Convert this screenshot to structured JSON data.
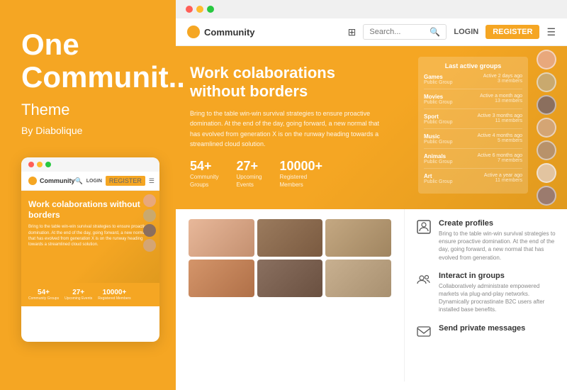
{
  "left_panel": {
    "title_line1": "One",
    "title_line2": "Communit..",
    "subtitle": "Theme",
    "author": "By Diabolique"
  },
  "mobile": {
    "logo": "Community",
    "hero_title": "Work colaborations without borders",
    "hero_body": "Bring to the table win-win survival strategies to ensure proactive domination. At the end of the day, going forward, a new normal that has evolved from generation X is on the runway heading towards a streamlined cloud solution.",
    "stats": [
      {
        "num": "54+",
        "label": "Community Groups"
      },
      {
        "num": "27+",
        "label": "Upcoming Events"
      },
      {
        "num": "10000+",
        "label": "Registered Members"
      }
    ],
    "nav_links": [
      "LOGIN",
      "REGISTER"
    ]
  },
  "desktop": {
    "logo": "Community",
    "search_placeholder": "Search...",
    "nav_login": "LOGIN",
    "nav_register": "REGISTER",
    "hero_title_bold": "Work colaborations",
    "hero_title_rest": "without borders",
    "hero_body": "Bring to the table win-win survival strategies to ensure proactive domination. At the end of the day, going forward, a new normal that has evolved from generation X is on the runway heading towards a streamlined cloud solution.",
    "stats": [
      {
        "num": "54+",
        "label": "Community\nGroups"
      },
      {
        "num": "27+",
        "label": "Upcoming\nEvents"
      },
      {
        "num": "10000+",
        "label": "Registered\nMembers"
      }
    ],
    "last_active_groups": {
      "title": "Last active groups",
      "items": [
        {
          "name": "Games",
          "type": "Public Group",
          "time": "Active 2 days ago",
          "members": "3 members"
        },
        {
          "name": "Movies",
          "type": "Public Group",
          "time": "Active a month ago",
          "members": "13 members"
        },
        {
          "name": "Sport",
          "type": "Public Group",
          "time": "Active 3 months ago",
          "members": "11 members"
        },
        {
          "name": "Music",
          "type": "Public Group",
          "time": "Active 4 months ago",
          "members": "5 members"
        },
        {
          "name": "Animals",
          "type": "Public Group",
          "time": "Active 6 months ago",
          "members": "7 members"
        },
        {
          "name": "Art",
          "type": "Public Group",
          "time": "Active a year ago",
          "members": "11 members"
        }
      ]
    },
    "features": [
      {
        "icon": "👤",
        "title": "Create profiles",
        "body": "Bring to the table win-win survival strategies to ensure proactive domination. At the end of the day, going forward, a new normal that has evolved from generation."
      },
      {
        "icon": "👥",
        "title": "Interact in groups",
        "body": "Collaboratively administrate empowered markets via plug-and-play networks. Dynamically procrastinate B2C users after installed base benefits."
      },
      {
        "icon": "✉",
        "title": "Send private messages",
        "body": ""
      }
    ]
  },
  "avatar_colors": [
    "#e8a87c",
    "#c9a96e",
    "#8b6f5e",
    "#d4a574",
    "#b8926a",
    "#e2c4a0",
    "#9b7b6e",
    "#d4956a"
  ],
  "photo_colors": [
    "#e8b89a",
    "#c4a882",
    "#a09070",
    "#d4c4a8",
    "#8a7060",
    "#c8b090"
  ],
  "accent_color": "#F5A623",
  "dots": {
    "red": "#ff5f57",
    "yellow": "#febc2e",
    "green": "#28c840"
  }
}
